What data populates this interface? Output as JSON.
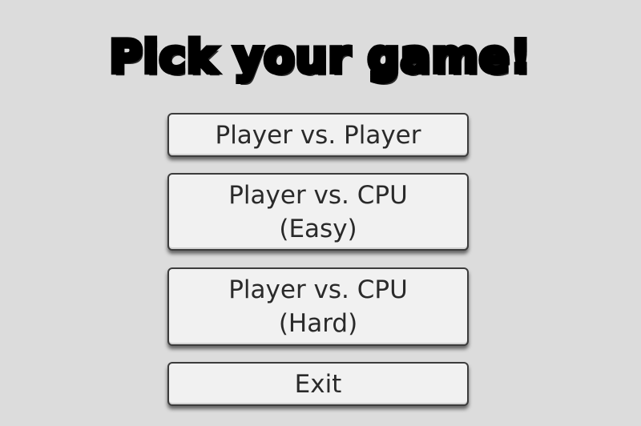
{
  "menu": {
    "title": "Pick your game!",
    "buttons": [
      {
        "line1": "Player vs. Player",
        "line2": ""
      },
      {
        "line1": "Player vs. CPU",
        "line2": "(Easy)"
      },
      {
        "line1": "Player vs. CPU",
        "line2": "(Hard)"
      },
      {
        "line1": "Exit",
        "line2": ""
      }
    ]
  },
  "colors": {
    "background": "#dcdcdc",
    "button_fill": "#f1f1f1",
    "button_border": "#3c3c3c",
    "button_text": "#2a2a2a",
    "title_text": "#000000"
  }
}
